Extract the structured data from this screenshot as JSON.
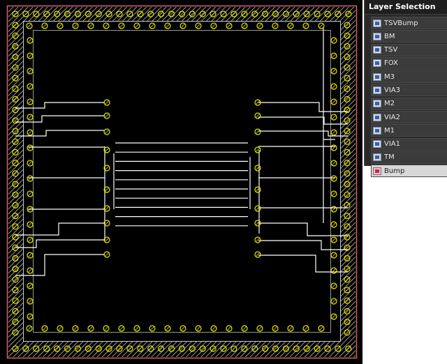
{
  "panel": {
    "title": "Layer Selection",
    "layers": [
      {
        "label": "TSVBump",
        "icon": "layer-icon"
      },
      {
        "label": "BM",
        "icon": "layer-icon"
      },
      {
        "label": "TSV",
        "icon": "layer-icon"
      },
      {
        "label": "FOX",
        "icon": "layer-icon"
      },
      {
        "label": "M3",
        "icon": "layer-icon"
      },
      {
        "label": "VIA3",
        "icon": "layer-icon"
      },
      {
        "label": "M2",
        "icon": "layer-icon"
      },
      {
        "label": "VIA2",
        "icon": "layer-icon"
      },
      {
        "label": "M1",
        "icon": "layer-icon"
      },
      {
        "label": "VIA1",
        "icon": "layer-icon"
      },
      {
        "label": "TM",
        "icon": "layer-icon"
      },
      {
        "label": "Bump",
        "icon": "bump-layer-icon",
        "selected": true
      }
    ]
  },
  "colors": {
    "canvas_background": "#000000",
    "die_outline": "#e06060",
    "hatch": "#bbbbbb",
    "bump": "#e6e600",
    "wire": "#ffffff",
    "panel_background": "#2a2a2a",
    "selected_row": "#d8d8d8"
  }
}
